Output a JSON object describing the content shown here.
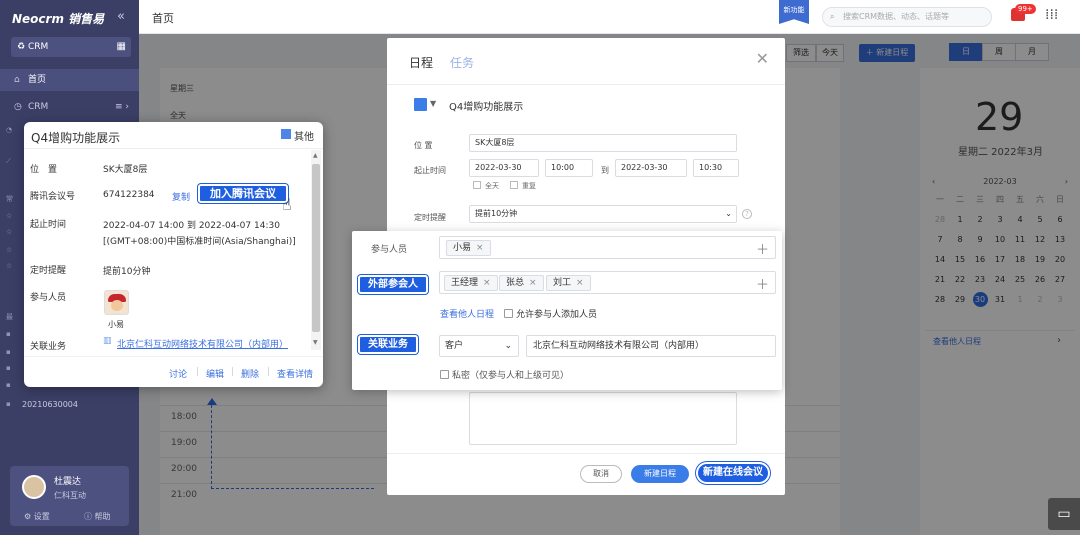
{
  "sidebar": {
    "logo": "Neocrm 销售易",
    "crm_label": "CRM",
    "nav": [
      {
        "label": "首页",
        "icon": "home-icon"
      },
      {
        "label": "CRM",
        "icon": "clock-icon"
      }
    ],
    "items": [
      "20210630004"
    ],
    "user": {
      "name": "杜震达",
      "company": "仁科互动"
    },
    "footer": {
      "settings": "设置",
      "help": "帮助"
    }
  },
  "topbar": {
    "title": "首页",
    "new_feature": "新功能",
    "search_placeholder": "搜索CRM数据、动态、话题等",
    "notification_badge": "99+"
  },
  "calendar": {
    "column_header": "星期三",
    "all_day": "全天",
    "hours": [
      "18:00",
      "19:00",
      "20:00",
      "21:00"
    ],
    "toolbar": {
      "filter": "筛选",
      "today": "今天",
      "new_schedule": "新建日程"
    },
    "view_tabs": [
      "日",
      "周",
      "月"
    ],
    "big_day": "29",
    "big_date": "星期二 2022年3月",
    "mini_month": "2022-03",
    "weekdays": [
      "一",
      "二",
      "三",
      "四",
      "五",
      "六",
      "日"
    ],
    "weeks": [
      [
        "28",
        "1",
        "2",
        "3",
        "4",
        "5",
        "6"
      ],
      [
        "7",
        "8",
        "9",
        "10",
        "11",
        "12",
        "13"
      ],
      [
        "14",
        "15",
        "16",
        "17",
        "18",
        "19",
        "20"
      ],
      [
        "21",
        "22",
        "23",
        "24",
        "25",
        "26",
        "27"
      ],
      [
        "28",
        "29",
        "30",
        "31",
        "1",
        "2",
        "3"
      ]
    ],
    "others_link": "查看他人日程"
  },
  "dialog": {
    "tab_schedule": "日程",
    "tab_task": "任务",
    "subject": "Q4增购功能展示",
    "color": "#3b7de8",
    "location_label": "位 置",
    "location_value": "SK大厦8层",
    "start_end_label": "起止时间",
    "start_date": "2022-03-30",
    "start_time": "10:00",
    "to_label": "到",
    "end_date": "2022-03-30",
    "end_time": "10:30",
    "all_day": "全天",
    "repeat": "重复",
    "reminder_label": "定时提醒",
    "reminder_value": "提前10分钟",
    "cancel": "取消",
    "new_schedule": "新建日程",
    "new_online_meeting": "新建在线会议"
  },
  "participants_panel": {
    "participants_label": "参与人员",
    "participants": [
      "小易"
    ],
    "external_label": "外部参会人",
    "external": [
      "王经理",
      "张总",
      "刘工"
    ],
    "view_others": "查看他人日程",
    "allow_add": "允许参与人添加人员",
    "related_label": "关联业务",
    "related_type": "客户",
    "related_company": "北京仁科互动网络技术有限公司（内部用）",
    "private": "私密（仅参与人和上级可见）"
  },
  "card": {
    "title": "Q4增购功能展示",
    "calendar": "其他",
    "calendar_color": "#4d86e8",
    "location_label": "位　置",
    "location_value": "SK大厦8层",
    "meeting_id_label": "腾讯会议号",
    "meeting_id": "674122384",
    "copy": "复制",
    "join": "加入腾讯会议",
    "time_label": "起止时间",
    "time_value": "2022-04-07  14:00  到  2022-04-07  14:30",
    "timezone": "[(GMT+08:00)中国标准时间(Asia/Shanghai)]",
    "reminder_label": "定时提醒",
    "reminder_value": "提前10分钟",
    "participants_label": "参与人员",
    "participant_name": "小易",
    "related_label": "关联业务",
    "related_value": "北京仁科互动网络技术有限公司（内部用）",
    "actions": [
      "讨论",
      "编辑",
      "删除",
      "查看详情"
    ]
  }
}
